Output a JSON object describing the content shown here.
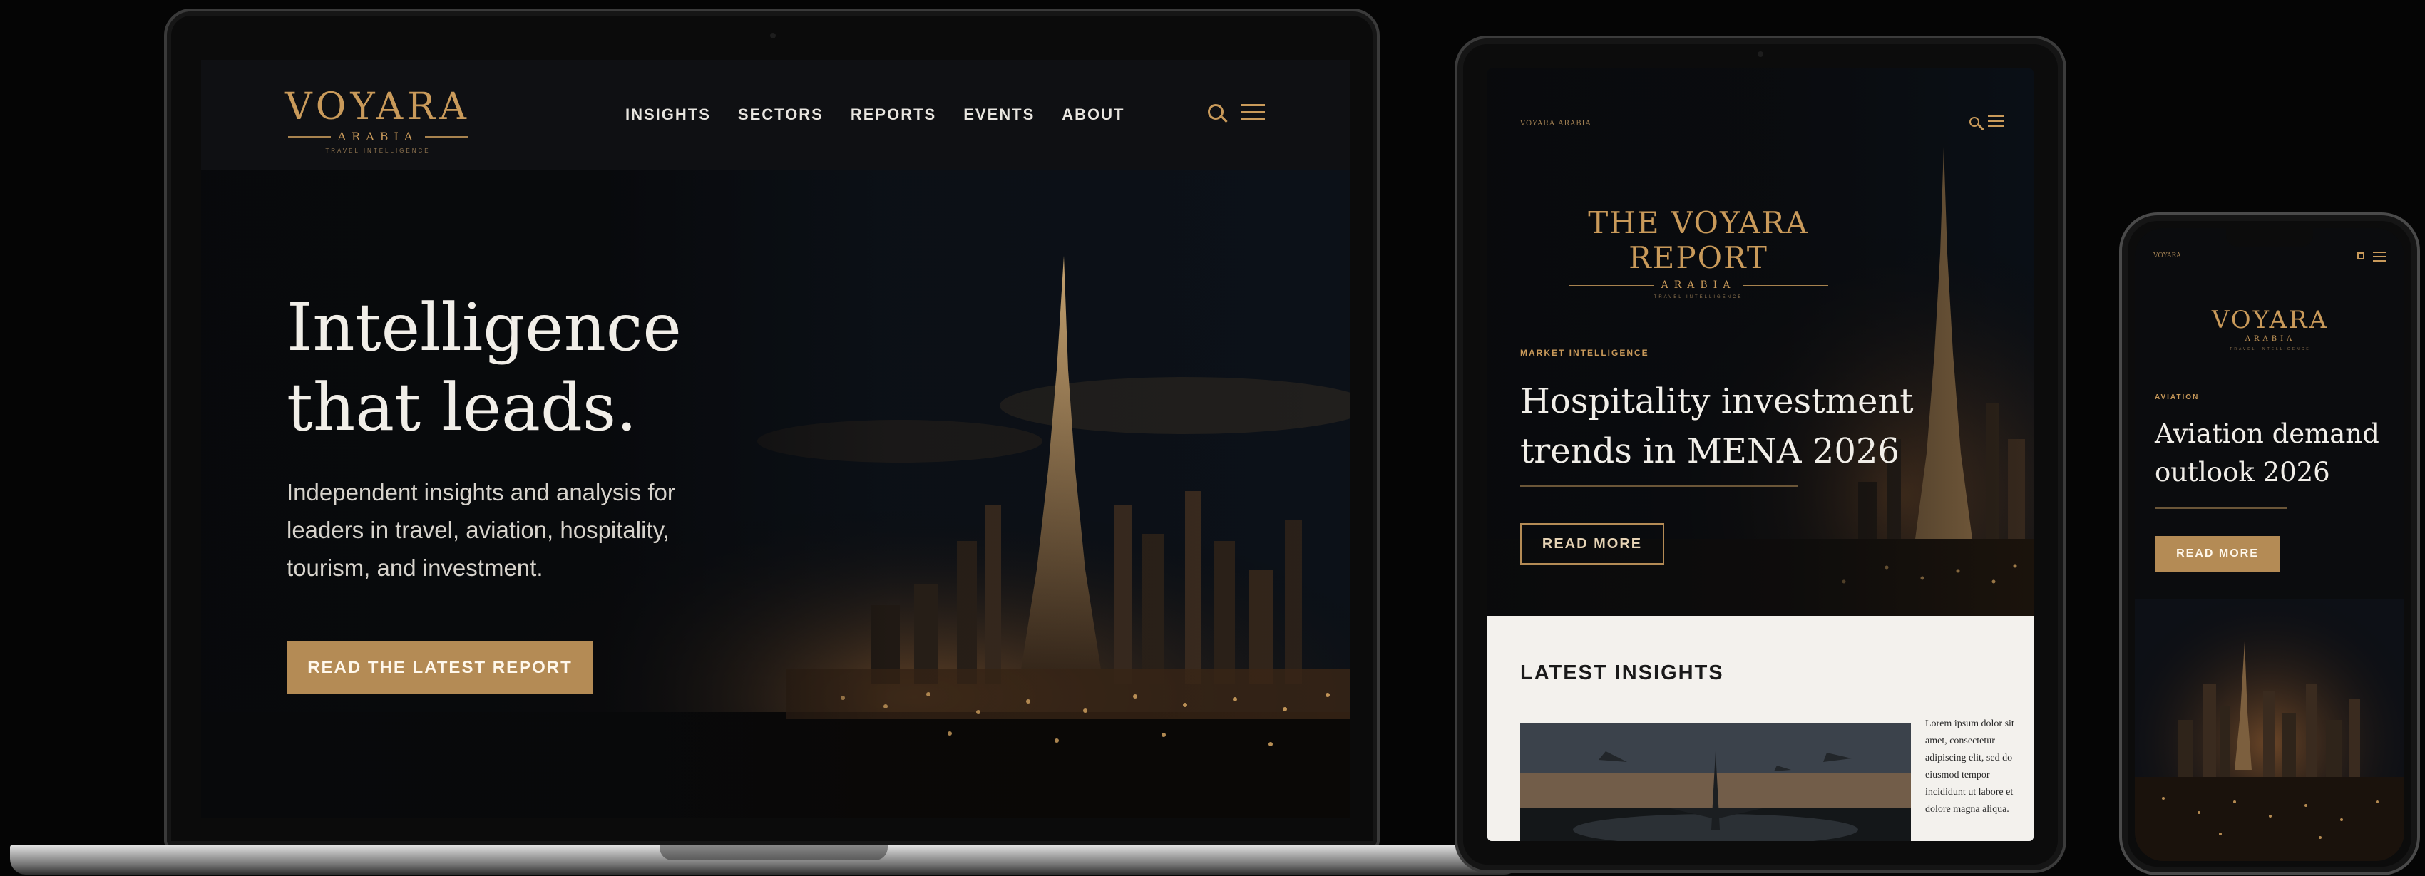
{
  "laptop": {
    "logo": {
      "word": "VOYARA",
      "sub": "ARABIA",
      "tag": "TRAVEL INTELLIGENCE"
    },
    "nav": [
      "INSIGHTS",
      "SECTORS",
      "REPORTS",
      "EVENTS",
      "ABOUT"
    ],
    "icons": [
      "search-icon",
      "menu-icon"
    ],
    "hero": {
      "title_line1": "Intelligence",
      "title_line2": "that leads.",
      "subtitle": "Independent insights and analysis for leaders in travel, aviation, hospitality, tourism, and investment.",
      "cta": "READ THE LATEST REPORT"
    }
  },
  "tablet": {
    "small_logo": "VOYARA ARABIA",
    "brand": {
      "word": "THE VOYARA REPORT",
      "sub": "ARABIA",
      "tag": "TRAVEL INTELLIGENCE"
    },
    "kicker": "MARKET INTELLIGENCE",
    "title": "Hospitality investment trends in MENA 2026",
    "button": "READ MORE",
    "insights_title": "LATEST INSIGHTS",
    "card_text": "Lorem ipsum dolor sit amet, consectetur adipiscing elit, sed do eiusmod tempor incididunt ut labore et dolore magna aliqua."
  },
  "phone": {
    "small_logo": "VOYARA",
    "brand": {
      "word": "VOYARA",
      "sub": "ARABIA",
      "tag": "TRAVEL INTELLIGENCE"
    },
    "kicker": "AVIATION",
    "title": "Aviation demand outlook 2026",
    "button": "READ MORE"
  },
  "colors": {
    "accent": "#b48b55",
    "gold_text": "#c99a5a",
    "background": "#0a0b0d",
    "light_panel": "#f3f1ed"
  }
}
